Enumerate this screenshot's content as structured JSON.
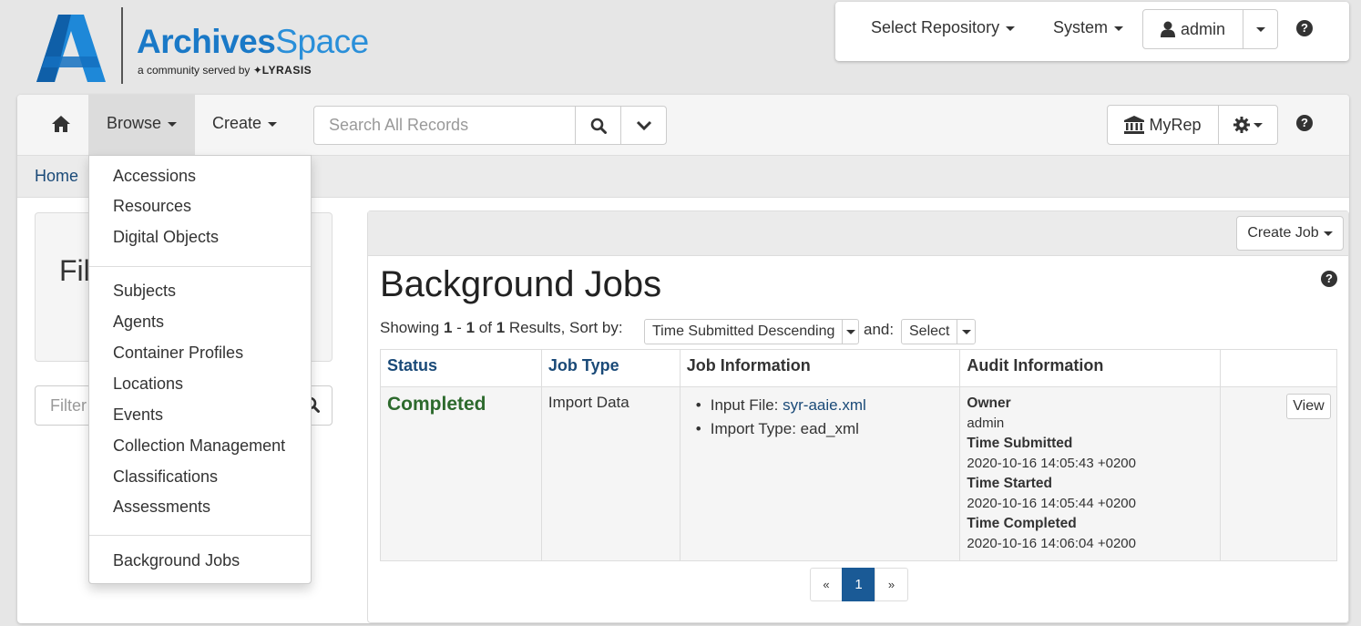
{
  "logo": {
    "word_bold": "Archives",
    "word_light": "Space",
    "tagline": "a community served by",
    "partner": "LYRASIS"
  },
  "topbar": {
    "select_repository": "Select Repository",
    "system": "System",
    "user": "admin"
  },
  "navbar": {
    "browse": "Browse",
    "create": "Create",
    "search_placeholder": "Search All Records",
    "myrep": "MyRep"
  },
  "breadcrumb": {
    "home": "Home"
  },
  "browse_menu": {
    "group1": [
      "Accessions",
      "Resources",
      "Digital Objects"
    ],
    "group2": [
      "Subjects",
      "Agents",
      "Container Profiles",
      "Locations",
      "Events",
      "Collection Management",
      "Classifications",
      "Assessments"
    ],
    "group3": [
      "Background Jobs"
    ]
  },
  "sidebar": {
    "filter_title": "Filter by",
    "filter_placeholder": "Filter by text"
  },
  "content": {
    "create_job": "Create Job",
    "title": "Background Jobs",
    "showing_prefix": "Showing",
    "range_start": "1",
    "range_sep": "-",
    "range_end": "1",
    "of_word": "of",
    "total": "1",
    "results_sort": "Results, Sort by:",
    "sort_value": "Time Submitted Descending",
    "and_label": "and:",
    "secondary_sort": "Select",
    "columns": {
      "status": "Status",
      "job_type": "Job Type",
      "job_info": "Job Information",
      "audit_info": "Audit Information"
    },
    "row": {
      "status": "Completed",
      "job_type": "Import Data",
      "input_file_label": "Input File:",
      "input_file": "syr-aaie.xml",
      "import_type_label": "Import Type:",
      "import_type": "ead_xml",
      "owner_label": "Owner",
      "owner": "admin",
      "submitted_label": "Time Submitted",
      "submitted": "2020-10-16 14:05:43 +0200",
      "started_label": "Time Started",
      "started": "2020-10-16 14:05:44 +0200",
      "completed_label": "Time Completed",
      "completed": "2020-10-16 14:06:04 +0200",
      "view": "View"
    },
    "pagination": {
      "prev": "«",
      "current": "1",
      "next": "»"
    }
  },
  "colors": {
    "brand_blue": "#1a79c7",
    "link_blue": "#1a4a78",
    "status_green": "#2d6a2d",
    "pager_active": "#1a5a96"
  }
}
